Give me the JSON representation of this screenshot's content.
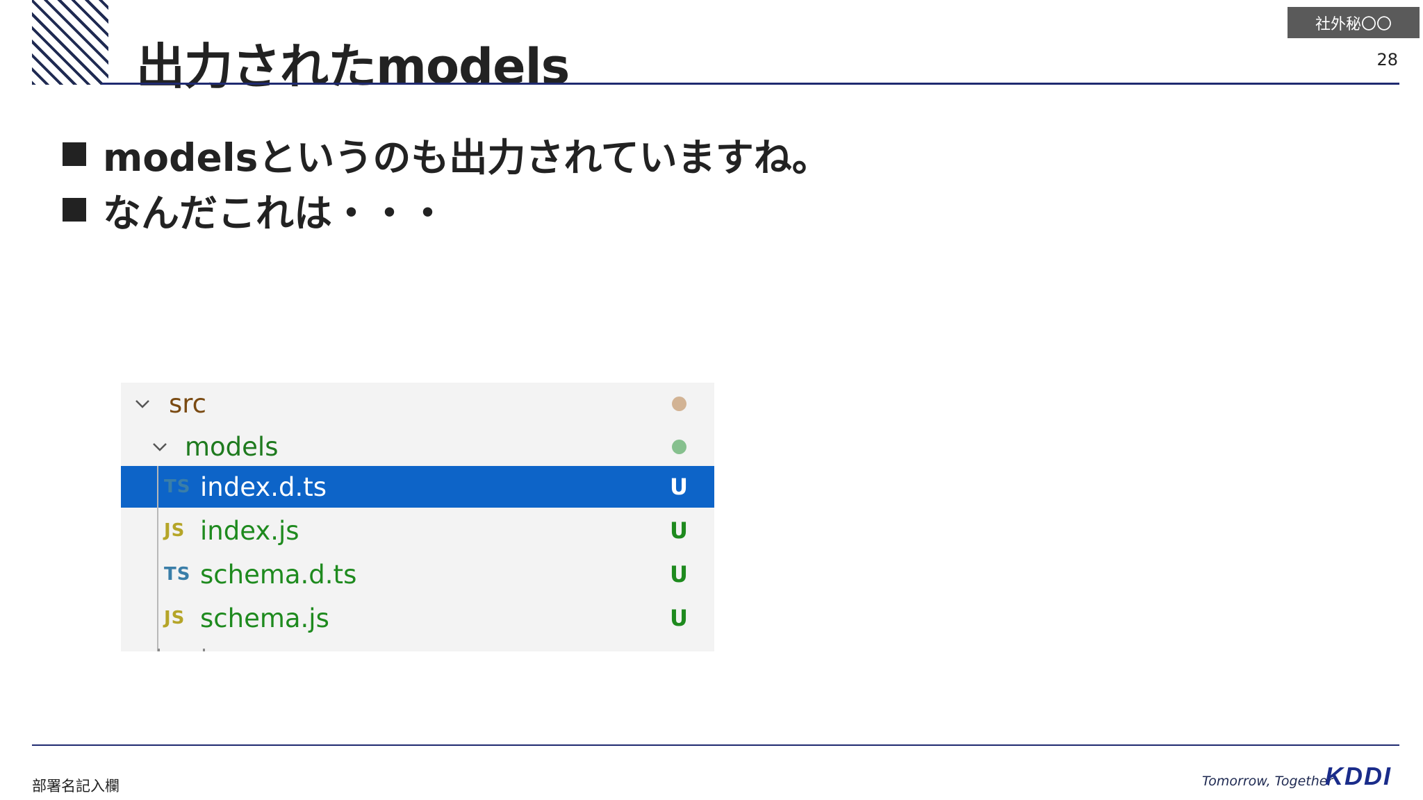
{
  "header": {
    "title": "出力されたmodels",
    "confidential_label": "社外秘〇〇",
    "page_number": "28"
  },
  "bullets": [
    {
      "text": "modelsというのも出力されていますね。"
    },
    {
      "text": "なんだこれは・・・"
    }
  ],
  "file_tree": {
    "folders": [
      {
        "name": "src",
        "status_color": "#d2b394",
        "label_color": "#7a4a12"
      },
      {
        "name": "models",
        "status_color": "#86c08e",
        "label_color": "#1e7a1e"
      }
    ],
    "files": [
      {
        "icon": "TS",
        "icon_name": "typescript-file-icon",
        "name": "index.d.ts",
        "badge": "U",
        "selected": true
      },
      {
        "icon": "JS",
        "icon_name": "javascript-file-icon",
        "name": "index.js",
        "badge": "U",
        "selected": false
      },
      {
        "icon": "TS",
        "icon_name": "typescript-file-icon",
        "name": "schema.d.ts",
        "badge": "U",
        "selected": false
      },
      {
        "icon": "JS",
        "icon_name": "javascript-file-icon",
        "name": "schema.js",
        "badge": "U",
        "selected": false
      }
    ],
    "colors": {
      "selection": "#0d64c8",
      "untracked_green": "#1e8a1e",
      "ts_icon": "#3a7ea8",
      "js_icon": "#b5a528"
    }
  },
  "footer": {
    "department": "部署名記入欄",
    "tagline": "Tomorrow, Together",
    "brand": "KDDI"
  }
}
